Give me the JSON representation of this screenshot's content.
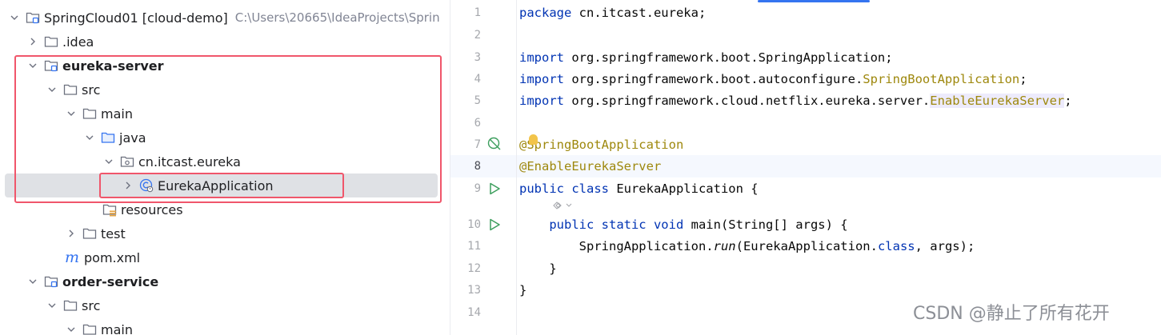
{
  "tree": {
    "items": [
      {
        "label": "SpringCloud01 [cloud-demo]",
        "path": "C:\\Users\\20665\\IdeaProjects\\Sprin",
        "icon": "module-folder-icon"
      },
      {
        "label": ".idea",
        "icon": "folder-icon"
      },
      {
        "label": "eureka-server",
        "icon": "module-folder-icon"
      },
      {
        "label": "src",
        "icon": "folder-icon"
      },
      {
        "label": "main",
        "icon": "folder-icon"
      },
      {
        "label": "java",
        "icon": "source-root-folder-icon"
      },
      {
        "label": "cn.itcast.eureka",
        "icon": "package-icon"
      },
      {
        "label": "EurekaApplication",
        "icon": "spring-boot-class-icon"
      },
      {
        "label": "resources",
        "icon": "resources-folder-icon"
      },
      {
        "label": "test",
        "icon": "folder-icon"
      },
      {
        "label": "pom.xml",
        "icon": "maven-icon"
      },
      {
        "label": "order-service",
        "icon": "module-folder-icon"
      },
      {
        "label": "src",
        "icon": "folder-icon"
      },
      {
        "label": "main",
        "icon": "folder-icon"
      }
    ]
  },
  "editor": {
    "line_numbers": [
      "1",
      "2",
      "3",
      "4",
      "5",
      "6",
      "7",
      "8",
      "9",
      "10",
      "11",
      "12",
      "13",
      "14"
    ],
    "current_line": "8",
    "code": {
      "l1_kw": "package",
      "l1_rest": " cn.itcast.eureka;",
      "l3_kw": "import",
      "l3_rest": " org.springframework.boot.SpringApplication;",
      "l4_kw": "import",
      "l4_rest": " org.springframework.boot.autoconfigure.",
      "l4_ann": "SpringBootApplication",
      "l4_end": ";",
      "l5_kw": "import",
      "l5_rest": " org.springframework.cloud.netflix.eureka.server.",
      "l5_hl": "EnableEurekaServer",
      "l5_end": ";",
      "l7": "@SpringBootApplication",
      "l8": "@EnableEurekaServer",
      "l9_kw": "public class",
      "l9_rest": " EurekaApplication {",
      "l10_indent": "    ",
      "l10_kw": "public static void",
      "l10_rest": " main(String[] args) {",
      "l11_a": "        SpringApplication.",
      "l11_it": "run",
      "l11_b": "(EurekaApplication.",
      "l11_kw": "class",
      "l11_c": ", args);",
      "l12": "    }",
      "l13": "}"
    }
  },
  "watermark": "CSDN @静止了所有花开",
  "colors": {
    "keyword": "#0033b3",
    "annotation": "#9e880d",
    "highlight_box": "#f0566b",
    "selection": "#dfe1e5"
  }
}
